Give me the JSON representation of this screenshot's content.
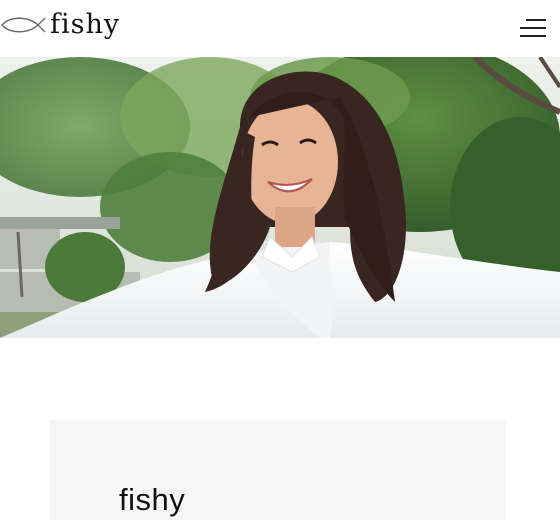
{
  "header": {
    "logo_text": "fishy",
    "logo_icon": "fish-outline-icon",
    "menu_icon": "hamburger-menu-icon"
  },
  "hero": {
    "image_description_icon": "hero-photo"
  },
  "content": {
    "card_title": "fishy"
  },
  "colors": {
    "background": "#ffffff",
    "card_background": "#f6f6f6",
    "text": "#111111"
  }
}
